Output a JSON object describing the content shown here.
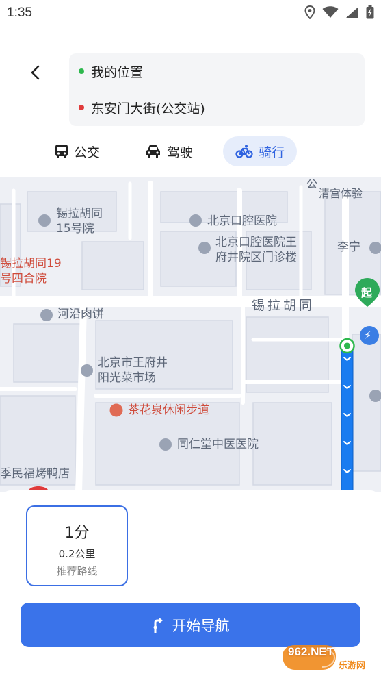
{
  "status_bar": {
    "time": "1:35",
    "icons": [
      "location-icon",
      "wifi-icon",
      "signal-icon",
      "battery-charging-icon"
    ]
  },
  "route": {
    "origin": "我的位置",
    "destination": "东安门大街(公交站)",
    "origin_color": "#2db84d",
    "destination_color": "#e03b3b"
  },
  "tabs": [
    {
      "label": "公交",
      "icon": "bus-icon",
      "active": false
    },
    {
      "label": "驾驶",
      "icon": "car-icon",
      "active": false
    },
    {
      "label": "骑行",
      "icon": "bicycle-icon",
      "active": true
    }
  ],
  "map": {
    "road_label": "锡拉胡同",
    "pois": [
      {
        "name": "公司...清宫体验",
        "line1": "公",
        "line2": "清宫体验"
      },
      {
        "name": "锡拉胡同15号院",
        "line1": "锡拉胡同",
        "line2": "15号院"
      },
      {
        "name": "北京口腔医院",
        "line1": "北京口腔医院",
        "line2": ""
      },
      {
        "name": "北京口腔医院王府井院区门诊楼",
        "line1": "北京口腔医院王",
        "line2": "府井院区门诊楼"
      },
      {
        "name": "李宁",
        "line1": "李宁",
        "line2": ""
      },
      {
        "name": "锡拉胡同19号四合院",
        "line1": "锡拉胡同19",
        "line2": "号四合院"
      },
      {
        "name": "河沿肉饼",
        "line1": "河沿肉饼",
        "line2": ""
      },
      {
        "name": "北京市王府井阳光菜市场",
        "line1": "北京市王府井",
        "line2": "阳光菜市场"
      },
      {
        "name": "茶花泉休闲步道",
        "line1": "茶花泉休闲步道",
        "line2": ""
      },
      {
        "name": "同仁堂中医医院",
        "line1": "同仁堂中医医院",
        "line2": ""
      },
      {
        "name": "季民福烤鸭店",
        "line1": "季民福烤鸭店",
        "line2": ""
      }
    ],
    "start_marker": "起",
    "route_color": "#1a7cf0"
  },
  "sheet": {
    "route_time": "1分",
    "route_distance": "0.2公里",
    "route_label": "推荐路线",
    "nav_button": "开始导航",
    "accent": "#3a73ea"
  },
  "watermark": {
    "text": "962.NET",
    "subtext": "乐游网"
  }
}
